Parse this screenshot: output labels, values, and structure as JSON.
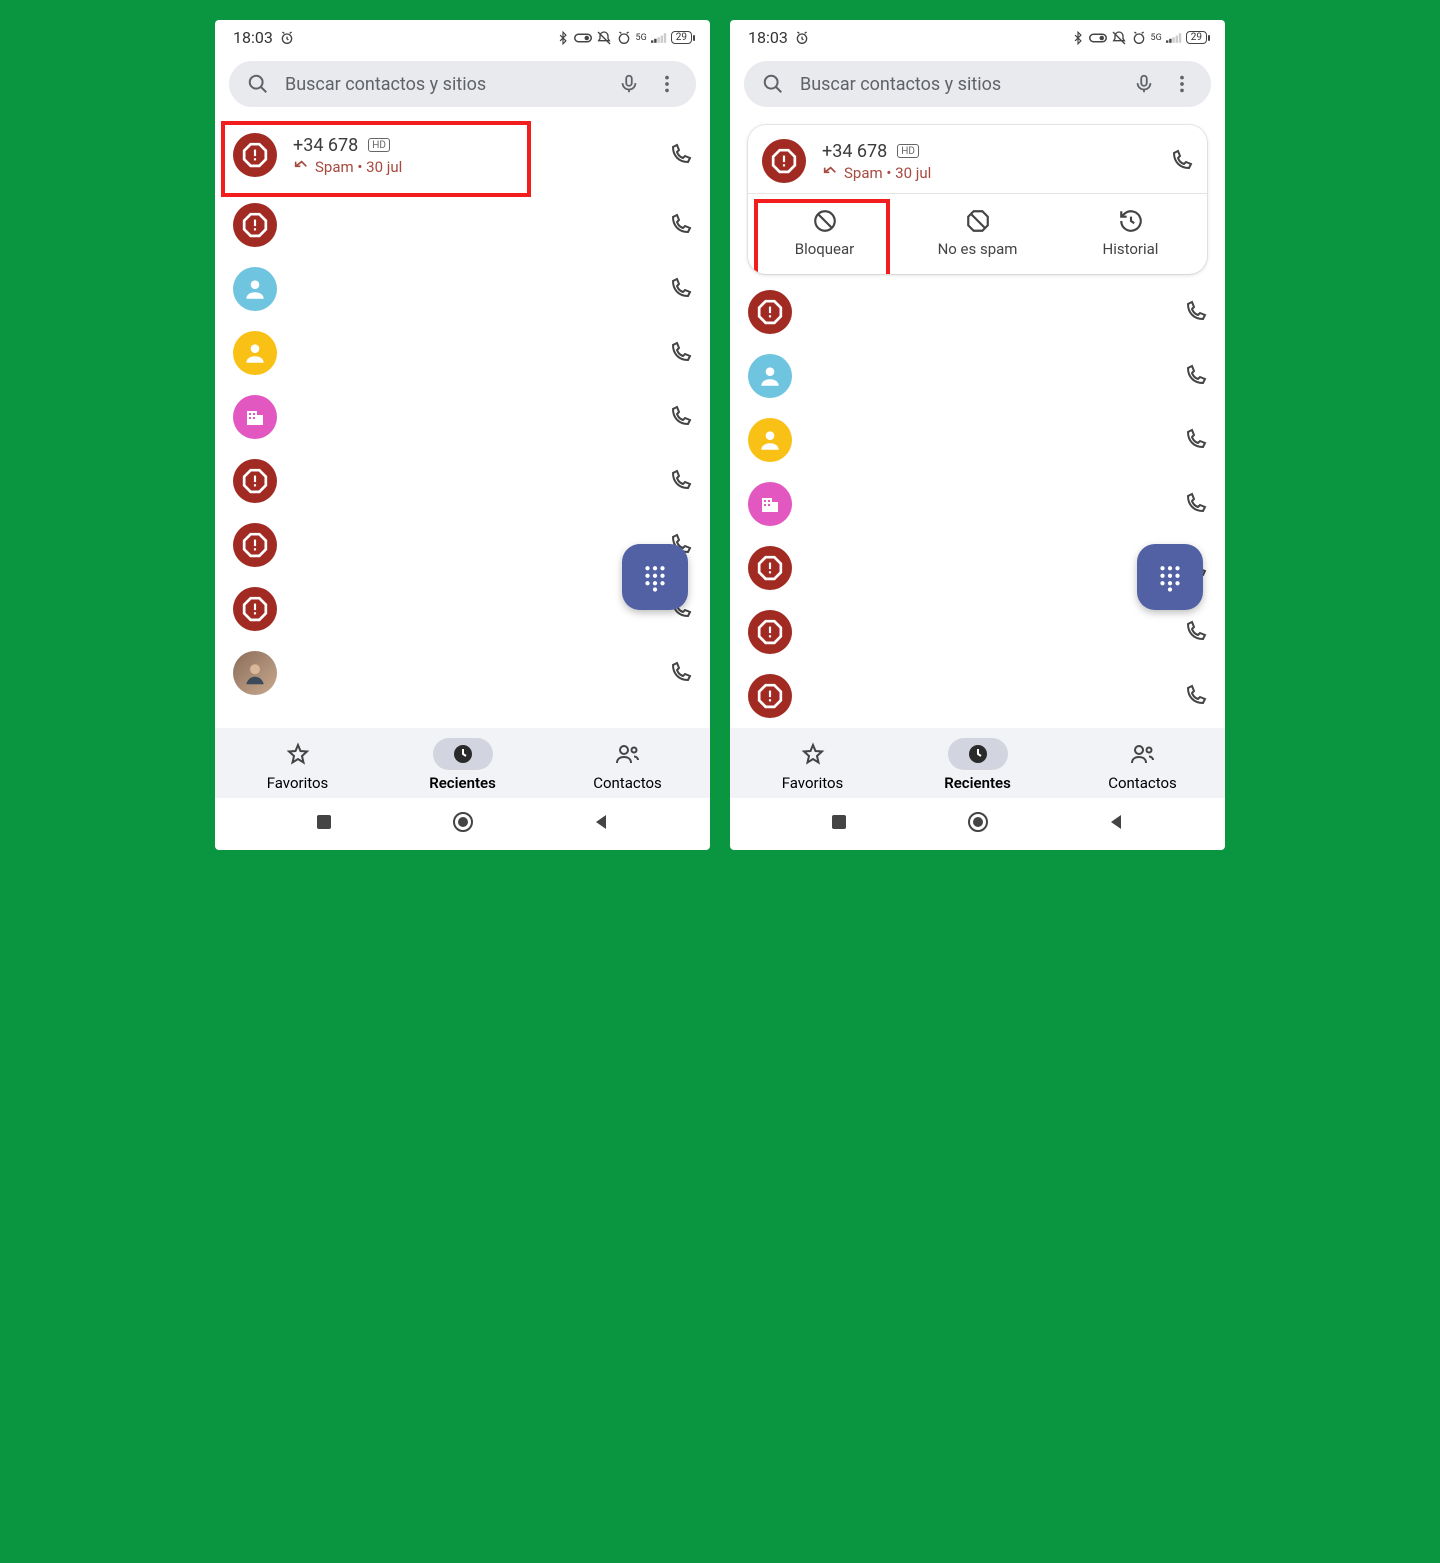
{
  "status": {
    "time": "18:03",
    "battery": "29",
    "net": "5G"
  },
  "search": {
    "placeholder": "Buscar contactos y sitios"
  },
  "calls": [
    {
      "number": "+34 678",
      "sub": "Spam • 30 jul",
      "avatar": "spam",
      "hd": true,
      "showText": true
    },
    {
      "avatar": "spam"
    },
    {
      "avatar": "blue"
    },
    {
      "avatar": "yellow"
    },
    {
      "avatar": "pink-building"
    },
    {
      "avatar": "spam"
    },
    {
      "avatar": "spam"
    },
    {
      "avatar": "spam"
    },
    {
      "avatar": "photo"
    }
  ],
  "actions": {
    "block": "Bloquear",
    "notspam": "No es spam",
    "history": "Historial"
  },
  "nav": {
    "fav": "Favoritos",
    "recent": "Recientes",
    "contacts": "Contactos"
  }
}
